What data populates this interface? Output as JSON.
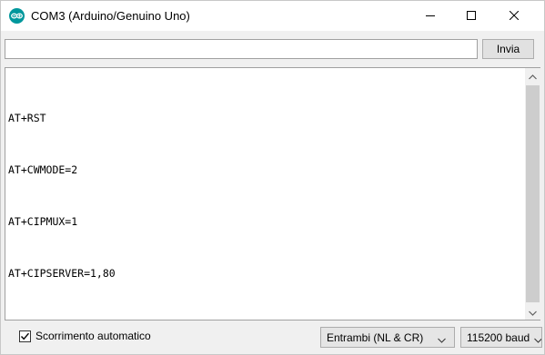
{
  "window": {
    "title": "COM3 (Arduino/Genuino Uno)",
    "icon": "arduino-logo-icon",
    "controls": [
      "minimize-icon",
      "maximize-icon",
      "close-icon"
    ]
  },
  "toolbar": {
    "input_value": "",
    "send_label": "Invia"
  },
  "output": {
    "lines": [
      "AT+RST",
      "AT+CWMODE=2",
      "AT+CIPMUX=1",
      "AT+CIPSERVER=1,80"
    ]
  },
  "status": {
    "autoscroll_label": "Scorrimento automatico",
    "autoscroll_checked": true,
    "line_ending": "Entrambi (NL & CR)",
    "baud_rate": "115200 baud"
  },
  "colors": {
    "arduino_teal": "#00979c"
  }
}
